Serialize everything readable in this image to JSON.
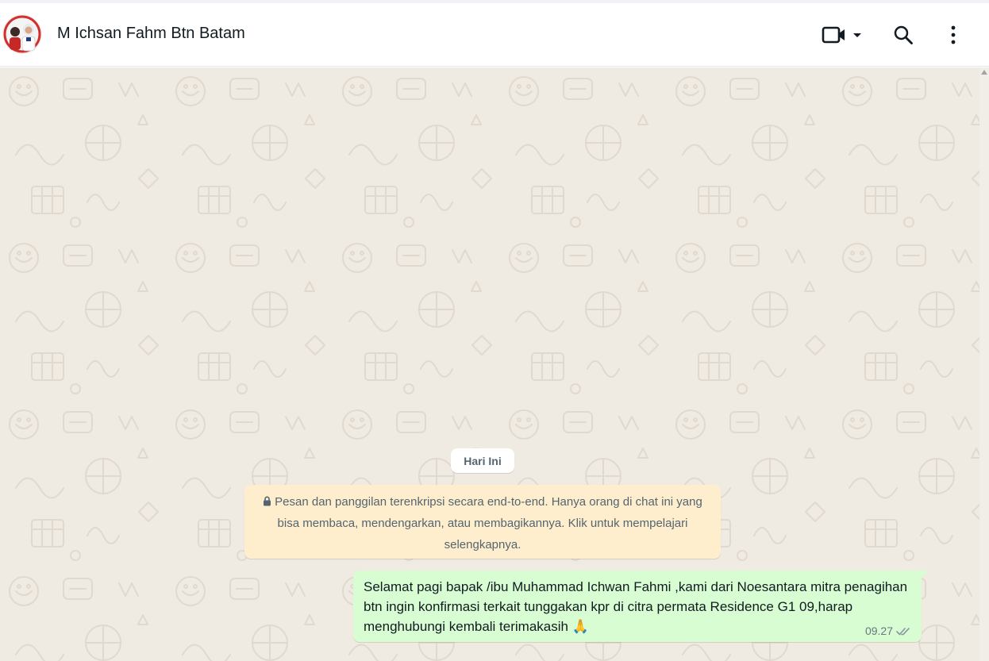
{
  "header": {
    "contact_name": "M Ichsan Fahm Btn Batam",
    "video_call_icon": "video-camera-icon",
    "video_dropdown_icon": "caret-down-icon",
    "search_icon": "search-icon",
    "menu_icon": "kebab-menu-icon"
  },
  "chat": {
    "date_divider": "Hari Ini",
    "encryption_notice": "Pesan dan panggilan terenkripsi secara end-to-end. Hanya orang di chat ini yang bisa membaca, mendengarkan, atau membagikannya. Klik untuk mempelajari selengkapnya.",
    "messages": [
      {
        "direction": "outgoing",
        "text": "Selamat pagi bapak /ibu Muhammad Ichwan Fahmi ,kami dari Noesantara mitra penagihan btn ingin konfirmasi terkait tunggakan kpr di citra permata Residence G1 09,harap menghubungi kembali terimakasih 🙏",
        "time": "09.27",
        "status_icon": "double-check-icon"
      }
    ]
  },
  "colors": {
    "wallpaper": "#efeae2",
    "outgoing_bubble": "#d9fdd3",
    "notice_bubble": "#ffeecd",
    "icon": "#54656f",
    "text": "#111b21",
    "meta_text": "#667781"
  }
}
